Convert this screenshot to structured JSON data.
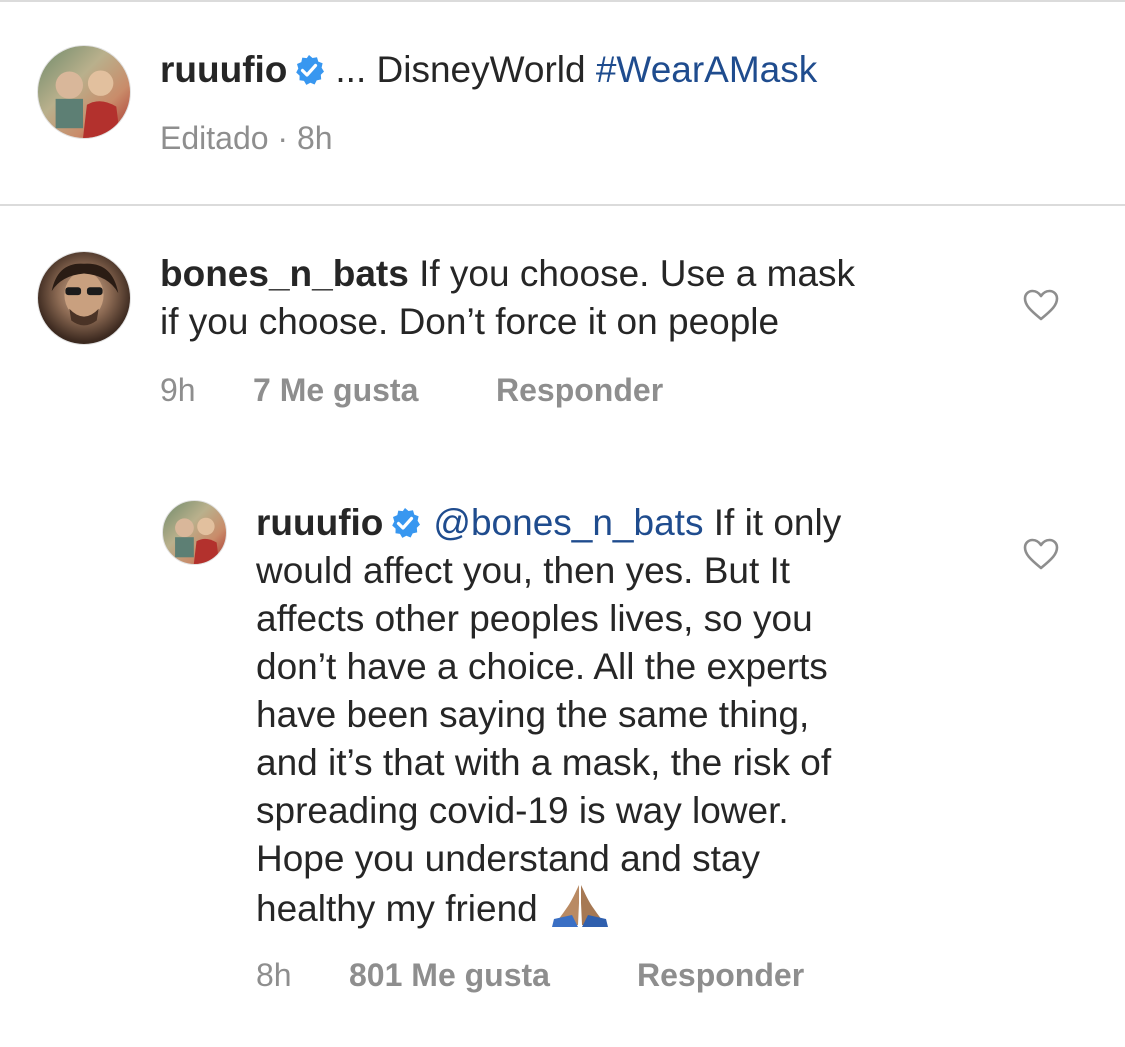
{
  "caption": {
    "username": "ruuufio",
    "verified_icon": "verified-badge-icon",
    "text_prefix": "... DisneyWorld ",
    "hashtag": "#WearAMask",
    "meta": "Editado · 8h"
  },
  "comments": [
    {
      "username": "bones_n_bats",
      "line1": " If you choose. Use a mask",
      "line2": "if you choose. Don’t force it on people",
      "time": "9h",
      "likes": "7 Me gusta",
      "reply_label": "Responder"
    },
    {
      "username": "ruuufio",
      "mention": "@bones_n_bats",
      "line1": " If it only",
      "lines": [
        "would affect you, then yes. But It",
        "affects other peoples lives, so you",
        "don’t have a choice. All the experts",
        "have been saying the same thing,",
        "and it’s that with a mask, the risk of",
        "spreading covid-19 is way lower.",
        "Hope you understand and stay",
        "healthy my friend"
      ],
      "emoji": "folded-hands-emoji",
      "time": "8h",
      "likes": "801 Me gusta",
      "reply_label": "Responder"
    }
  ],
  "icons": {
    "like": "heart-outline-icon"
  },
  "colors": {
    "text": "#262626",
    "muted": "#8e8e8e",
    "link": "#1f4c8e",
    "verified": "#3897f0",
    "divider": "#dbdbdb"
  }
}
